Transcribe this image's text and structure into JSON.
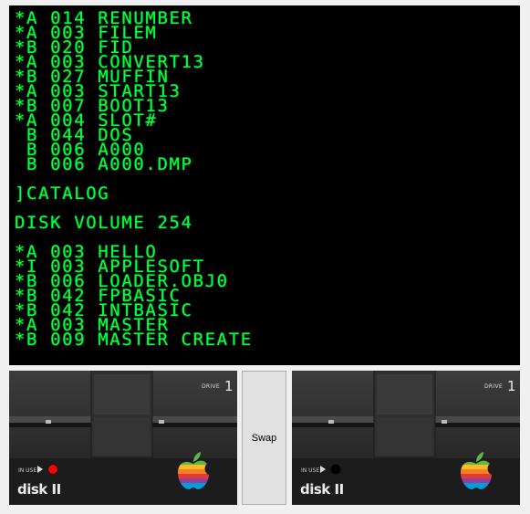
{
  "screen": {
    "lines": [
      "*A 014 RENUMBER",
      "*A 003 FILEM",
      "*B 020 FID",
      "*A 003 CONVERT13",
      "*B 027 MUFFIN",
      "*A 003 START13",
      "*B 007 BOOT13",
      "*A 004 SLOT#",
      " B 044 DOS",
      " B 006 A000",
      " B 006 A000.DMP",
      "",
      "]CATALOG",
      "",
      "DISK VOLUME 254",
      "",
      "*A 003 HELLO",
      "*I 003 APPLESOFT",
      "*B 006 LOADER.OBJ0",
      "*B 042 FPBASIC",
      "*B 042 INTBASIC",
      "*A 003 MASTER",
      "*B 009 MASTER CREATE"
    ],
    "text_color": "#00ff3c",
    "background": "#000000"
  },
  "drives": {
    "left": {
      "label": "DRIVE",
      "number": "1",
      "in_use_label": "IN USE",
      "brand": "disk II",
      "led_on": true,
      "led_color": "#ff0000"
    },
    "right": {
      "label": "DRIVE",
      "number": "1",
      "in_use_label": "IN USE",
      "brand": "disk II",
      "led_on": false,
      "led_color": "#000000"
    }
  },
  "swap_button": {
    "label": "Swap"
  }
}
